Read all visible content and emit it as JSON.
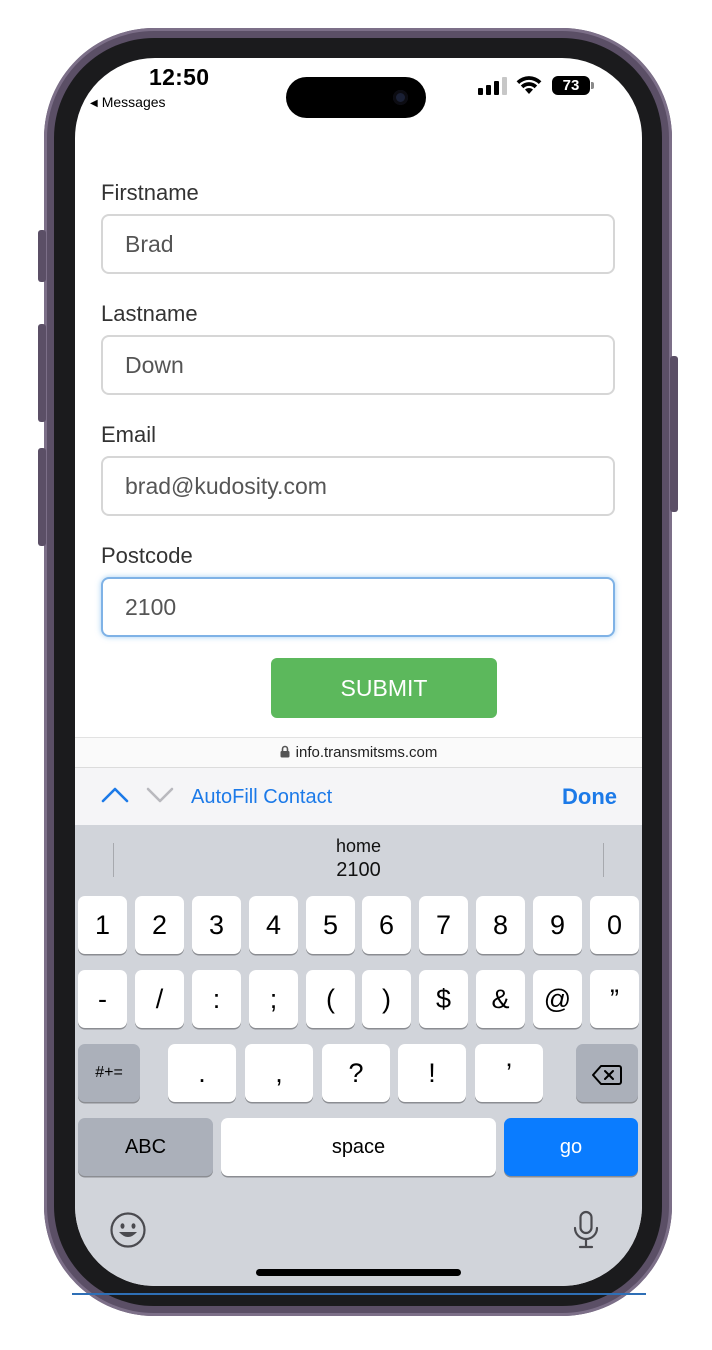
{
  "status_bar": {
    "time": "12:50",
    "back_label": "Messages",
    "battery": "73"
  },
  "form": {
    "fields": [
      {
        "label": "Firstname",
        "value": "Brad"
      },
      {
        "label": "Lastname",
        "value": "Down"
      },
      {
        "label": "Email",
        "value": "brad@kudosity.com"
      },
      {
        "label": "Postcode",
        "value": "2100"
      }
    ],
    "submit_label": "SUBMIT"
  },
  "url_bar": {
    "domain": "info.transmitsms.com"
  },
  "accessory": {
    "autofill_label": "AutoFill Contact",
    "done_label": "Done"
  },
  "keyboard": {
    "suggestion_title": "home",
    "suggestion_value": "2100",
    "row1": [
      "1",
      "2",
      "3",
      "4",
      "5",
      "6",
      "7",
      "8",
      "9",
      "0"
    ],
    "row2": [
      "-",
      "/",
      ":",
      ";",
      "(",
      ")",
      "$",
      "&",
      "@",
      "”"
    ],
    "row3": [
      ".",
      ",",
      "?",
      "!",
      "’"
    ],
    "symbols_key": "#+=",
    "abc_key": "ABC",
    "space_key": "space",
    "go_key": "go"
  },
  "icons": {
    "back": "back-triangle-icon",
    "signal": "cellular-signal-icon",
    "wifi": "wifi-icon",
    "battery": "battery-icon",
    "lock": "lock-icon",
    "up": "chevron-up-icon",
    "down": "chevron-down-icon",
    "backspace": "backspace-icon",
    "emoji": "emoji-icon",
    "mic": "microphone-icon"
  },
  "colors": {
    "accent_blue": "#1c7ae8",
    "go_key_blue": "#0a7cff",
    "submit_green": "#5cb85c",
    "phone_frame": "#5b4f66"
  }
}
